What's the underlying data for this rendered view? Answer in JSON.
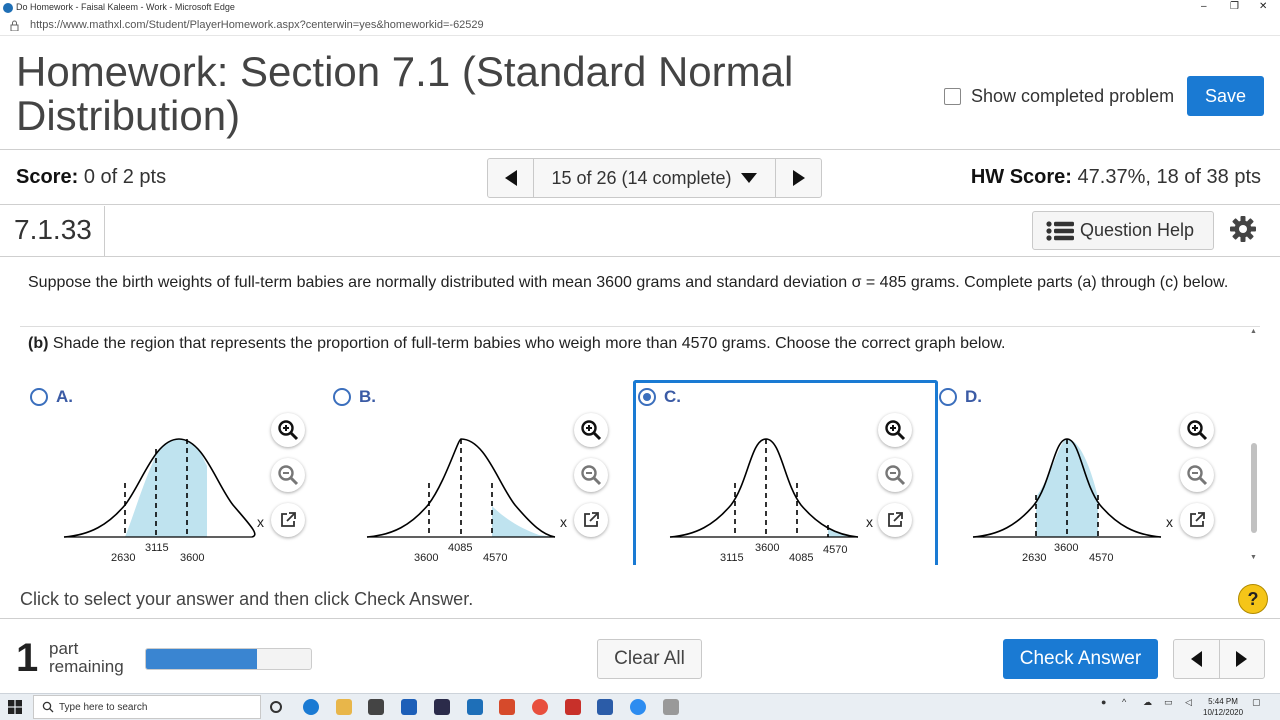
{
  "browser": {
    "window_title": "Do Homework - Faisal Kaleem - Work - Microsoft Edge",
    "url": "https://www.mathxl.com/Student/PlayerHomework.aspx?centerwin=yes&homeworkid=-62529"
  },
  "header": {
    "title": "Homework: Section 7.1 (Standard Normal Distribution)",
    "show_completed_label": "Show completed problem",
    "save_label": "Save"
  },
  "scorebar": {
    "score_label": "Score:",
    "score_value": "0 of 2 pts",
    "nav_position": "15 of 26 (14 complete)",
    "hw_score_label": "HW Score:",
    "hw_score_value": "47.37%, 18 of 38 pts"
  },
  "question": {
    "number": "7.1.33",
    "help_label": "Question Help",
    "prompt": "Suppose the birth weights of full-term babies are normally distributed with mean 3600 grams and standard deviation σ = 485 grams. Complete parts (a) through (c) below.",
    "part_label": "(b)",
    "part_text": "Shade the region that represents the proportion of full-term babies who weigh more than 4570 grams. Choose the correct graph below."
  },
  "choices": [
    {
      "letter": "A.",
      "selected": false,
      "ticks": [
        "2630",
        "3115",
        "3600"
      ],
      "axis_label": "x"
    },
    {
      "letter": "B.",
      "selected": false,
      "ticks": [
        "3600",
        "4085",
        "4570"
      ],
      "axis_label": "x"
    },
    {
      "letter": "C.",
      "selected": true,
      "ticks": [
        "3115",
        "3600",
        "4085",
        "4570"
      ],
      "axis_label": "x"
    },
    {
      "letter": "D.",
      "selected": false,
      "ticks": [
        "2630",
        "3600",
        "4570"
      ],
      "axis_label": "x"
    }
  ],
  "footer": {
    "instructions": "Click to select your answer and then click Check Answer.",
    "parts_remaining_count": "1",
    "parts_remaining_line1": "part",
    "parts_remaining_line2": "remaining",
    "progress_fraction": 0.67,
    "clear_label": "Clear All",
    "check_label": "Check Answer"
  },
  "taskbar": {
    "search_placeholder": "Type here to search",
    "time": "5:44 PM",
    "date": "10/12/2020"
  },
  "colors": {
    "accent": "#1a7ad3",
    "shade": "#bfe3ef",
    "choice_letter": "#3b5ba5"
  }
}
